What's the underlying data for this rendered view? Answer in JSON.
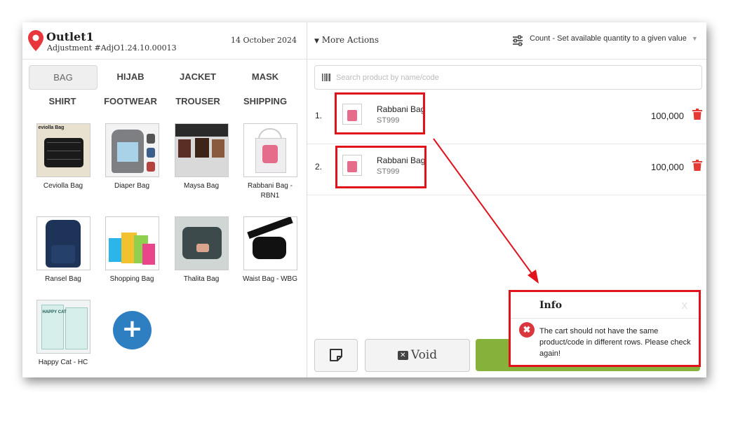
{
  "header": {
    "outlet_name": "Outlet1",
    "adjustment_label": "Adjustment #AdjO1.24.10.00013",
    "date": "14 October 2024"
  },
  "categories": [
    "BAG",
    "HIJAB",
    "JACKET",
    "MASK",
    "SHIRT",
    "FOOTWEAR",
    "TROUSER",
    "SHIPPING"
  ],
  "active_category": "BAG",
  "products": [
    {
      "name": "Ceviolla Bag",
      "image_text": "eviolla Bag"
    },
    {
      "name": "Diaper Bag"
    },
    {
      "name": "Maysa Bag"
    },
    {
      "name": "Rabbani Bag - RBN1"
    },
    {
      "name": "Ransel Bag"
    },
    {
      "name": "Shopping Bag"
    },
    {
      "name": "Thalita Bag"
    },
    {
      "name": "Waist Bag - WBG"
    },
    {
      "name": "Happy Cat - HC",
      "image_text": "HAPPY CAT"
    }
  ],
  "add_product_icon": "plus-icon",
  "toolbar": {
    "more_actions": "More Actions",
    "count_mode": "Count - Set available quantity to a given value"
  },
  "search": {
    "placeholder": "Search product by name/code",
    "value": ""
  },
  "cart": [
    {
      "index": "1.",
      "name": "Rabbani Bag",
      "code": "ST999",
      "qty": "100,000"
    },
    {
      "index": "2.",
      "name": "Rabbani Bag",
      "code": "ST999",
      "qty": "100,000"
    }
  ],
  "actions": {
    "void_label": "Void",
    "void_icon": "x-box-icon",
    "note_icon": "note-icon"
  },
  "dialog": {
    "title": "Info",
    "close_label": "X",
    "message": "The cart should not have the same product/code in different rows. Please check again!"
  },
  "colors": {
    "brand_blue": "#2e7ec2",
    "primary_green": "#86b23b",
    "danger_red": "#e0121b",
    "delete_icon": "#e53935",
    "error_icon": "#d9363e"
  }
}
